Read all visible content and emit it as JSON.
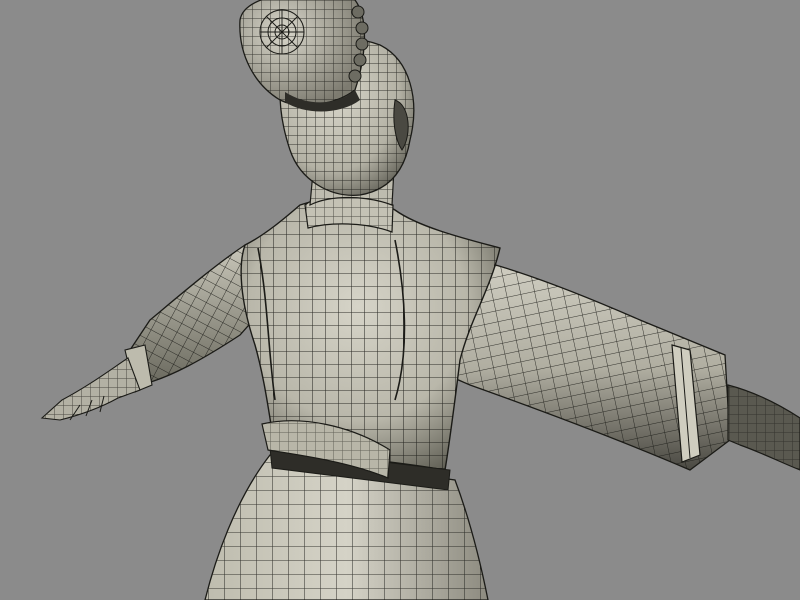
{
  "scene": {
    "subject": "t-pose-character-wireframe",
    "view": "back-three-quarter",
    "shading": "smooth-shaded-with-wireframe-overlay"
  },
  "colors": {
    "background": "#8b8b8b",
    "mesh_light": "#d2d0c4",
    "mesh_mid": "#a7a598",
    "mesh_dark": "#3b3a33",
    "wire": "#1c1c18"
  }
}
